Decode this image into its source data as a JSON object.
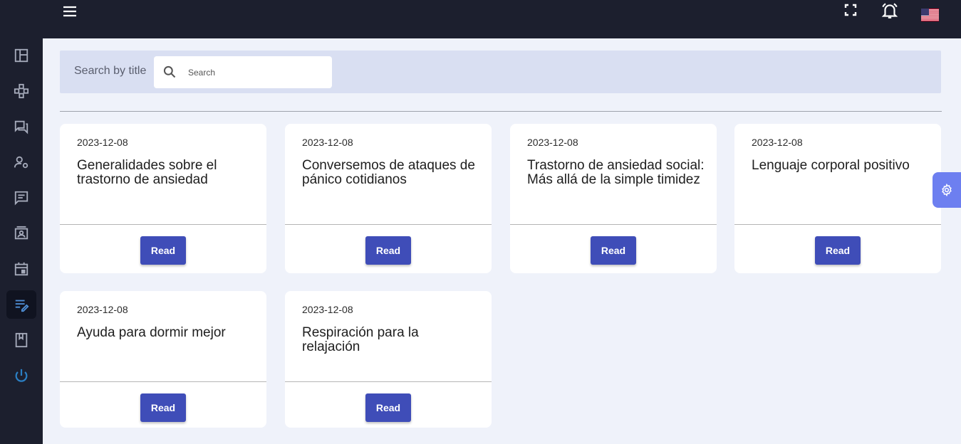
{
  "topbar": {
    "icons": [
      "menu-icon",
      "fullscreen-icon",
      "bell-icon",
      "us-flag-icon"
    ]
  },
  "sidebar": {
    "items": [
      {
        "icon": "dashboard-icon"
      },
      {
        "icon": "gamepad-icon"
      },
      {
        "icon": "forum-icon"
      },
      {
        "icon": "user-settings-icon"
      },
      {
        "icon": "message-icon"
      },
      {
        "icon": "contacts-icon"
      },
      {
        "icon": "calendar-icon"
      },
      {
        "icon": "edit-notes-icon",
        "active": true
      },
      {
        "icon": "book-icon"
      },
      {
        "icon": "power-icon"
      }
    ]
  },
  "search": {
    "label": "Search by title",
    "placeholder": "Search",
    "value": ""
  },
  "cards": [
    {
      "date": "2023-12-08",
      "title": "Generalidades sobre el trastorno de ansiedad",
      "button": "Read"
    },
    {
      "date": "2023-12-08",
      "title": "Conversemos de ataques de pánico cotidianos",
      "button": "Read"
    },
    {
      "date": "2023-12-08",
      "title": "Trastorno de ansiedad social: Más allá de la simple timidez",
      "button": "Read"
    },
    {
      "date": "2023-12-08",
      "title": "Lenguaje corporal positivo",
      "button": "Read"
    },
    {
      "date": "2023-12-08",
      "title": "Ayuda para dormir mejor",
      "button": "Read"
    },
    {
      "date": "2023-12-08",
      "title": "Respiración para la relajación",
      "button": "Read"
    }
  ],
  "colors": {
    "sidebar_bg": "#1c1f2e",
    "accent": "#3f4db8",
    "settings_tab": "#6d7ff0",
    "page_bg": "#eff2fa"
  }
}
